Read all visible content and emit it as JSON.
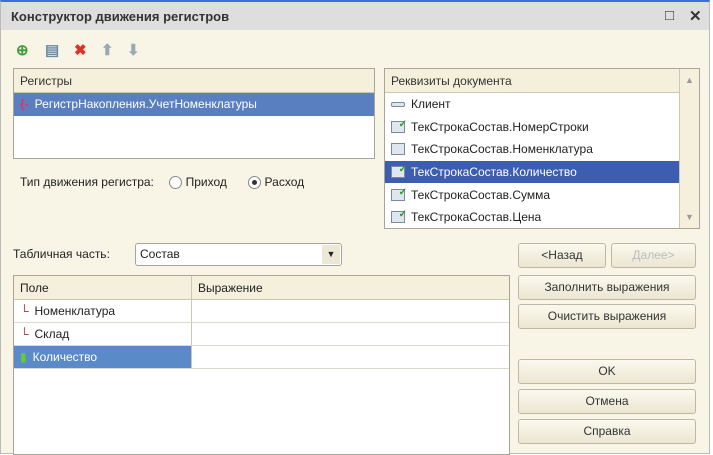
{
  "window": {
    "title": "Конструктор движения регистров",
    "maximize_icon": "□",
    "close_icon": "✕"
  },
  "toolbar": {
    "add": "⊕",
    "add_copy": "▤",
    "delete": "✖",
    "up": "⬆",
    "down": "⬇"
  },
  "registers": {
    "header": "Регистры",
    "items": [
      "РегистрНакопления.УчетНоменклатуры"
    ]
  },
  "movement_type": {
    "label": "Тип движения регистра:",
    "options": [
      "Приход",
      "Расход"
    ],
    "selected": "Расход"
  },
  "requisites": {
    "header": "Реквизиты документа",
    "items": [
      "Клиент",
      "ТекСтрокаСостав.НомерСтроки",
      "ТекСтрокаСостав.Номенклатура",
      "ТекСтрокаСостав.Количество",
      "ТекСтрокаСостав.Сумма",
      "ТекСтрокаСостав.Цена"
    ],
    "selected_index": 3
  },
  "tabular": {
    "label": "Табличная часть:",
    "value": "Состав"
  },
  "grid": {
    "columns": [
      "Поле",
      "Выражение"
    ],
    "rows": [
      {
        "field": "Номенклатура",
        "expr": ""
      },
      {
        "field": "Склад",
        "expr": ""
      },
      {
        "field": "Количество",
        "expr": ""
      }
    ]
  },
  "buttons": {
    "back": "<Назад",
    "next": "Далее>",
    "fill": "Заполнить выражения",
    "clear": "Очистить выражения",
    "ok": "OK",
    "cancel": "Отмена",
    "help": "Справка"
  }
}
